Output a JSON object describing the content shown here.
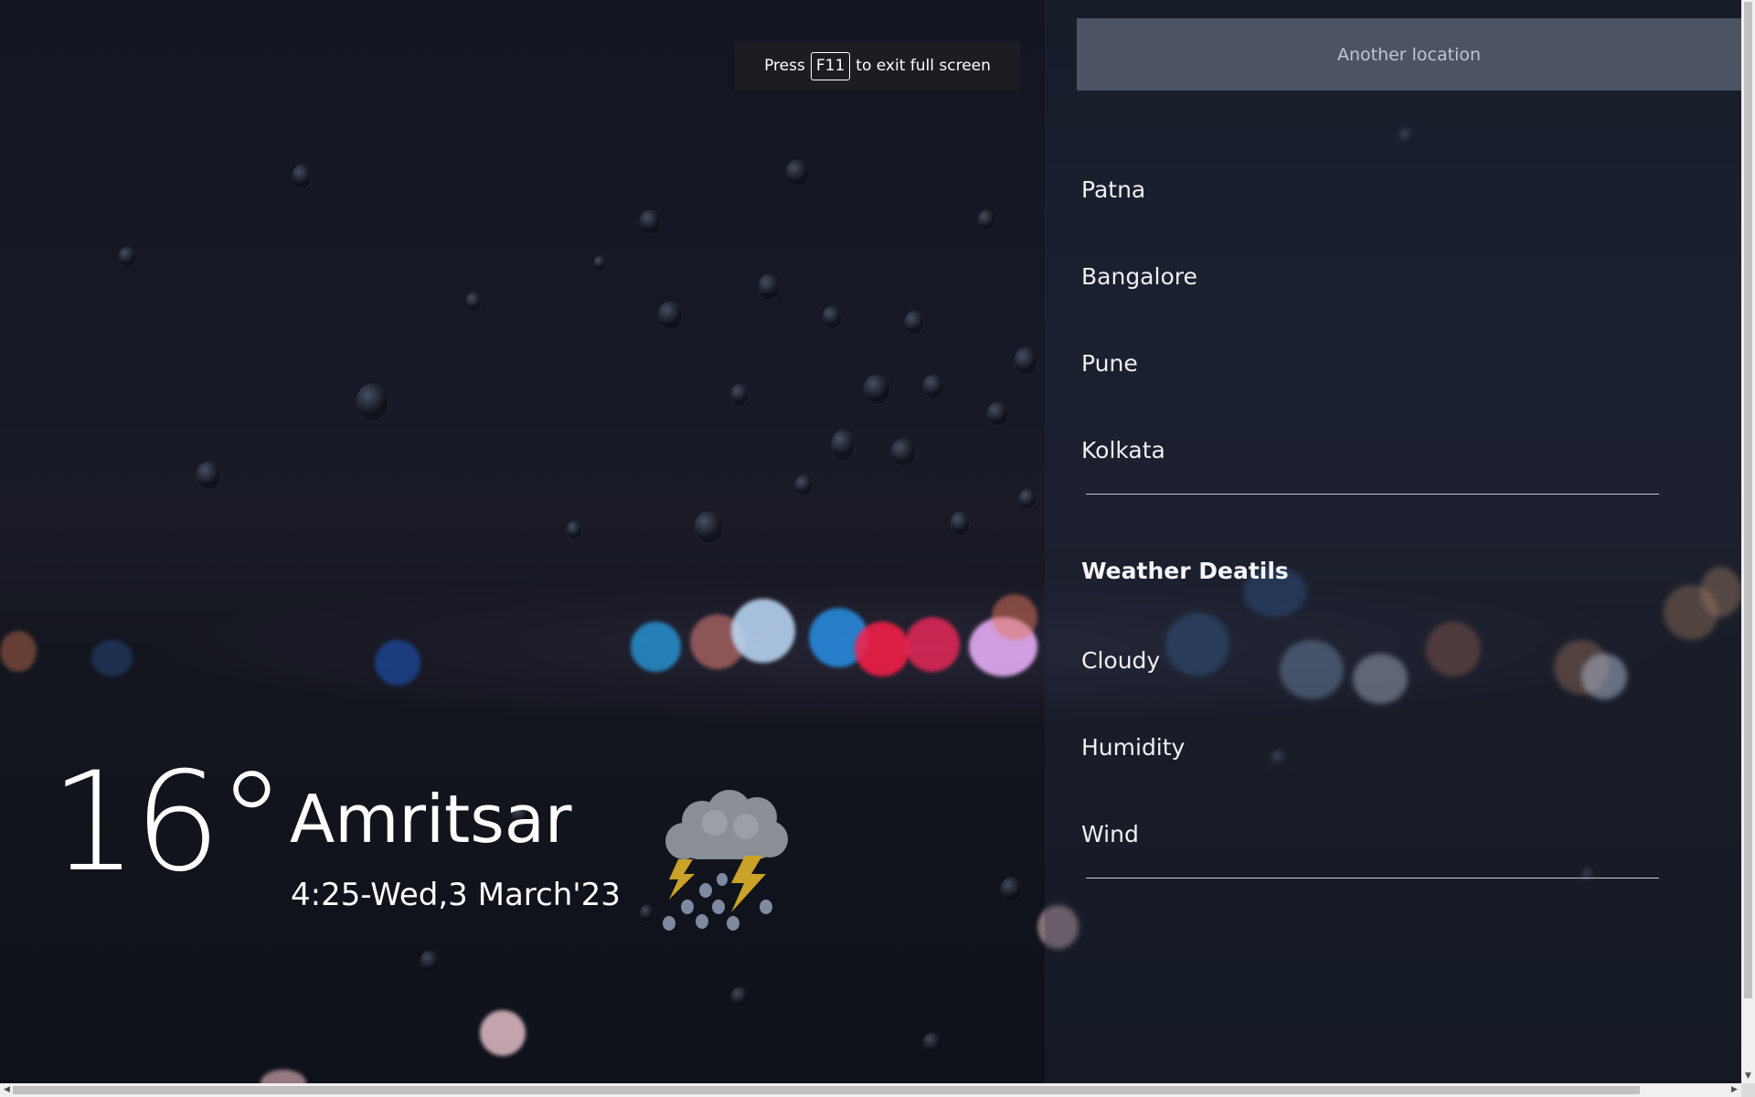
{
  "search": {
    "placeholder": "Another location"
  },
  "fullscreen_notice": {
    "prefix": "Press",
    "key": "F11",
    "suffix": "to exit full screen"
  },
  "cities": [
    {
      "label": "Patna"
    },
    {
      "label": "Bangalore"
    },
    {
      "label": "Pune"
    },
    {
      "label": "Kolkata"
    }
  ],
  "details": {
    "title": "Weather Deatils",
    "rows": [
      {
        "label": "Cloudy"
      },
      {
        "label": "Humidity"
      },
      {
        "label": "Wind"
      }
    ]
  },
  "current": {
    "temperature": "16°",
    "city": "Amritsar",
    "datetime": "4:25-Wed,3 March'23",
    "condition_icon": "thunderstorm-icon"
  },
  "colors": {
    "panel_overlay": "#283246",
    "search_bg": "#78808f",
    "divider": "#c8ccd6",
    "lightning": "#c9a227",
    "cloud": "#8a8e96"
  }
}
